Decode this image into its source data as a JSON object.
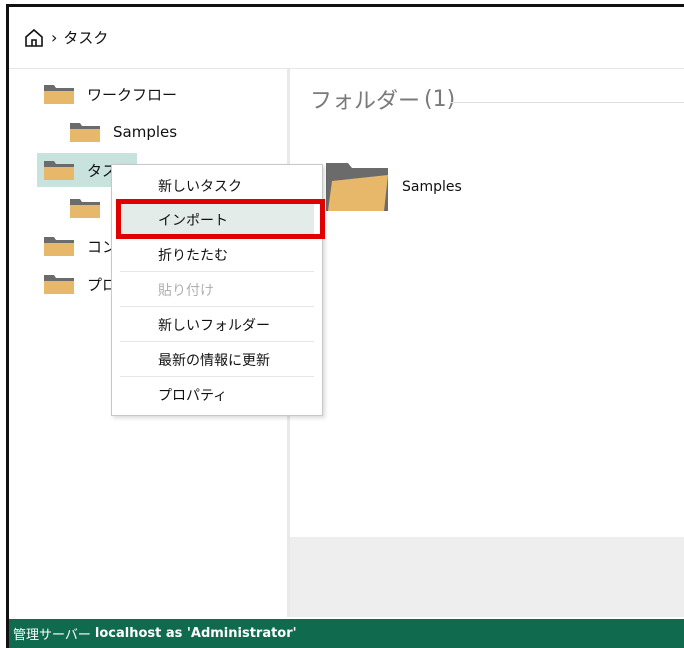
{
  "breadcrumb": {
    "current": "タスク"
  },
  "tree": {
    "items": [
      {
        "label": "ワークフロー"
      },
      {
        "label": "Samples"
      },
      {
        "label": "タスク"
      },
      {
        "label": ""
      },
      {
        "label": "コン"
      },
      {
        "label": "プロ"
      }
    ]
  },
  "content": {
    "section_title": "フォルダー",
    "section_count": "(1)",
    "folder_label": "Samples"
  },
  "context_menu": {
    "items": [
      {
        "label": "新しいタスク"
      },
      {
        "label": "インポート"
      },
      {
        "label": "折りたたむ"
      },
      {
        "label": "貼り付け"
      },
      {
        "label": "新しいフォルダー"
      },
      {
        "label": "最新の情報に更新"
      },
      {
        "label": "プロパティ"
      }
    ]
  },
  "status_bar": {
    "prefix": "管理サーバー",
    "connection": "localhost as 'Administrator'"
  },
  "colors": {
    "folder": "#e8b86a",
    "folder_back": "#6b6b6b",
    "status_bg": "#0f6a4e",
    "selected_bg": "#c8e3dd",
    "highlight_border": "#e00000"
  }
}
